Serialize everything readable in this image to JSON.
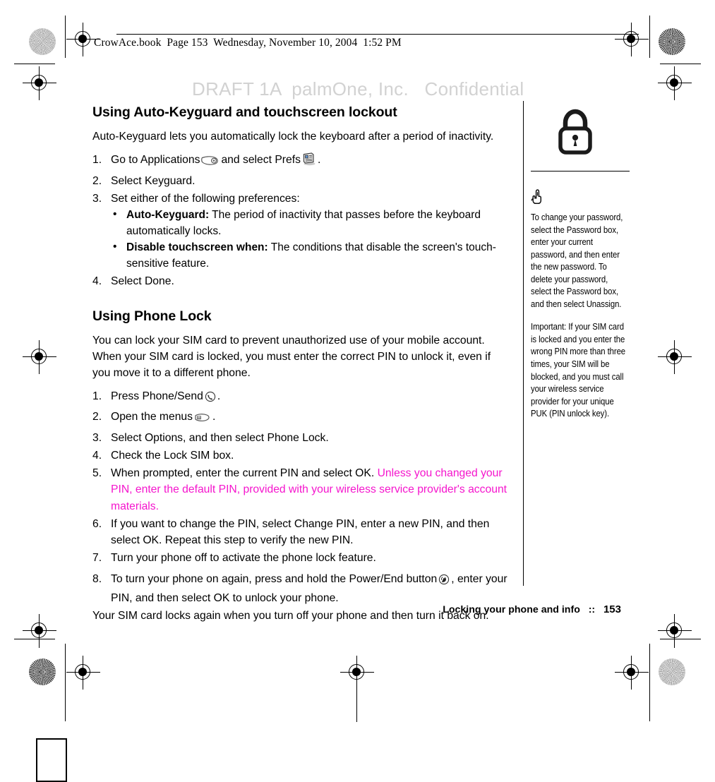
{
  "print_header": {
    "text": "CrowAce.book  Page 153  Wednesday, November 10, 2004  1:52 PM"
  },
  "watermark": {
    "text": "DRAFT 1A  palmOne, Inc.   Confidential",
    "color": "#d2d2d2"
  },
  "main": {
    "section1": {
      "title": "Using Auto-Keyguard and touchscreen lockout",
      "intro": "Auto-Keyguard lets you automatically lock the keyboard after a period of inactivity.",
      "steps": [
        {
          "num": "1.",
          "text_before": "Go to Applications",
          "icon1": "applications-stylus-icon",
          "text_mid": "and select Prefs",
          "icon2": "prefs-icon",
          "text_after": "."
        },
        {
          "num": "2.",
          "text": "Select Keyguard."
        },
        {
          "num": "3.",
          "text": "Set either of the following preferences:",
          "bullets": [
            {
              "bullet": "•",
              "term": "Auto-Keyguard:",
              "desc": "The period of inactivity that passes before the keyboard automatically locks."
            },
            {
              "bullet": "•",
              "term": "Disable touchscreen when:",
              "desc": "The conditions that disable the screen's touch-sensitive feature."
            }
          ]
        },
        {
          "num": "4.",
          "text": "Select Done."
        }
      ]
    },
    "section2": {
      "title": "Using Phone Lock",
      "intro": "You can lock your SIM card to prevent unauthorized use of your mobile account. When your SIM card is locked, you must enter the correct PIN to unlock it, even if you move it to a different phone.",
      "steps": [
        {
          "num": "1.",
          "text_before": "Press Phone/Send",
          "icon1": "phone-send-icon",
          "text_after": "."
        },
        {
          "num": "2.",
          "text_before": "Open the menus",
          "icon1": "menu-icon",
          "text_after": "."
        },
        {
          "num": "3.",
          "text": "Select Options, and then select Phone Lock."
        },
        {
          "num": "4.",
          "text": "Check the Lock SIM box."
        },
        {
          "num": "5.",
          "text": "When prompted, enter the current PIN and select OK. ",
          "highlight": "Unless you changed your  PIN, enter the default PIN, provided with your wireless service provider's account  materials."
        },
        {
          "num": "6.",
          "text": "If you want to change the PIN, select Change PIN, enter a new PIN, and then select OK. Repeat this step to verify the new PIN."
        },
        {
          "num": "7.",
          "text": "Turn your phone off to activate the phone lock feature."
        },
        {
          "num": "8.",
          "text_before": "To turn your phone on again, press and hold the Power/End button",
          "icon1": "power-end-icon",
          "text_after": ", enter your PIN, and then select OK to unlock your phone."
        }
      ],
      "closing": "Your SIM card locks again when you turn off your phone and then turn it back on."
    },
    "highlight_color": "#f515cd"
  },
  "sidebar": {
    "lock_icon": "padlock-icon",
    "tip_icon": "pointing-hand-tip-icon",
    "tip": "To change your password, select the Password box, enter your current password, and then enter the new password. To delete your password, select the Password box, and then select Unassign.",
    "important": "Important: If your SIM card is locked and you enter the wrong PIN more than three times, your SIM will be blocked, and you must call your wireless service provider for your unique PUK (PIN unlock key)."
  },
  "footer": {
    "text": "Locking your phone and info   ::   ",
    "page": "153"
  }
}
